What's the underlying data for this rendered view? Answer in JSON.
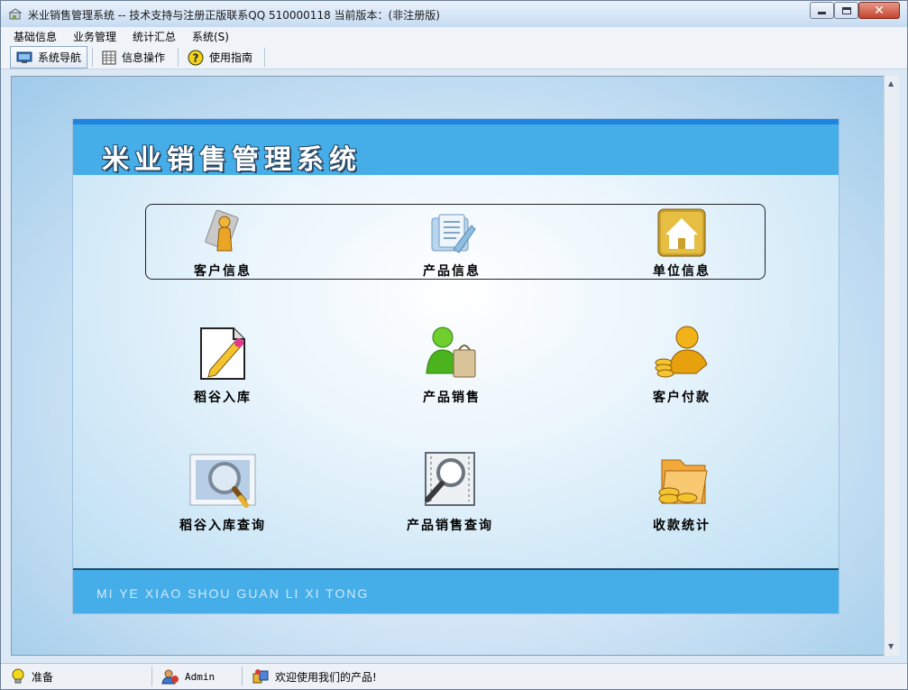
{
  "window": {
    "title": "米业销售管理系统 -- 技术支持与注册正版联系QQ 510000118    当前版本：(非注册版)"
  },
  "menu": [
    "基础信息",
    "业务管理",
    "统计汇总",
    "系统(S)"
  ],
  "toolbar": {
    "nav": "系统导航",
    "info": "信息操作",
    "guide": "使用指南"
  },
  "panel": {
    "title": "米业销售管理系统",
    "footer": "MI YE XIAO SHOU GUAN LI XI TONG",
    "top_items": [
      {
        "label": "客户信息",
        "icon": "customer-info-icon"
      },
      {
        "label": "产品信息",
        "icon": "product-info-icon"
      },
      {
        "label": "单位信息",
        "icon": "unit-info-icon"
      }
    ],
    "mid_items": [
      {
        "label": "稻谷入库",
        "icon": "stock-in-icon"
      },
      {
        "label": "产品销售",
        "icon": "sales-icon"
      },
      {
        "label": "客户付款",
        "icon": "payment-icon"
      }
    ],
    "bottom_items": [
      {
        "label": "稻谷入库查询",
        "icon": "stock-in-query-icon"
      },
      {
        "label": "产品销售查询",
        "icon": "sales-query-icon"
      },
      {
        "label": "收款统计",
        "icon": "receipt-stats-icon"
      }
    ]
  },
  "status": {
    "ready": "准备",
    "user": "Admin",
    "welcome": "欢迎使用我们的产品!"
  }
}
